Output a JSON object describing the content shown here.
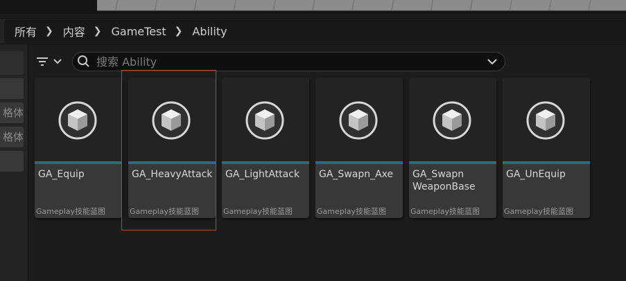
{
  "breadcrumb": [
    "所有",
    "内容",
    "GameTest",
    "Ability"
  ],
  "left_panel": {
    "items": [
      "",
      "格体",
      "格体",
      ""
    ]
  },
  "toolbar": {
    "search_placeholder": "搜索 Ability"
  },
  "assets": [
    {
      "name": "GA_Equip",
      "type": "Gameplay技能蓝图"
    },
    {
      "name": "GA_HeavyAttack",
      "type": "Gameplay技能蓝图"
    },
    {
      "name": "GA_LightAttack",
      "type": "Gameplay技能蓝图"
    },
    {
      "name": "GA_Swapn_Axe",
      "type": "Gameplay技能蓝图"
    },
    {
      "name": "GA_Swapn WeaponBase",
      "type": "Gameplay技能蓝图"
    },
    {
      "name": "GA_UnEquip",
      "type": "Gameplay技能蓝图"
    }
  ],
  "selected_asset": "GA_HeavyAttack",
  "colors": {
    "accent_bar": "#1e6e8e",
    "selection_outline": "#d03a3a"
  }
}
